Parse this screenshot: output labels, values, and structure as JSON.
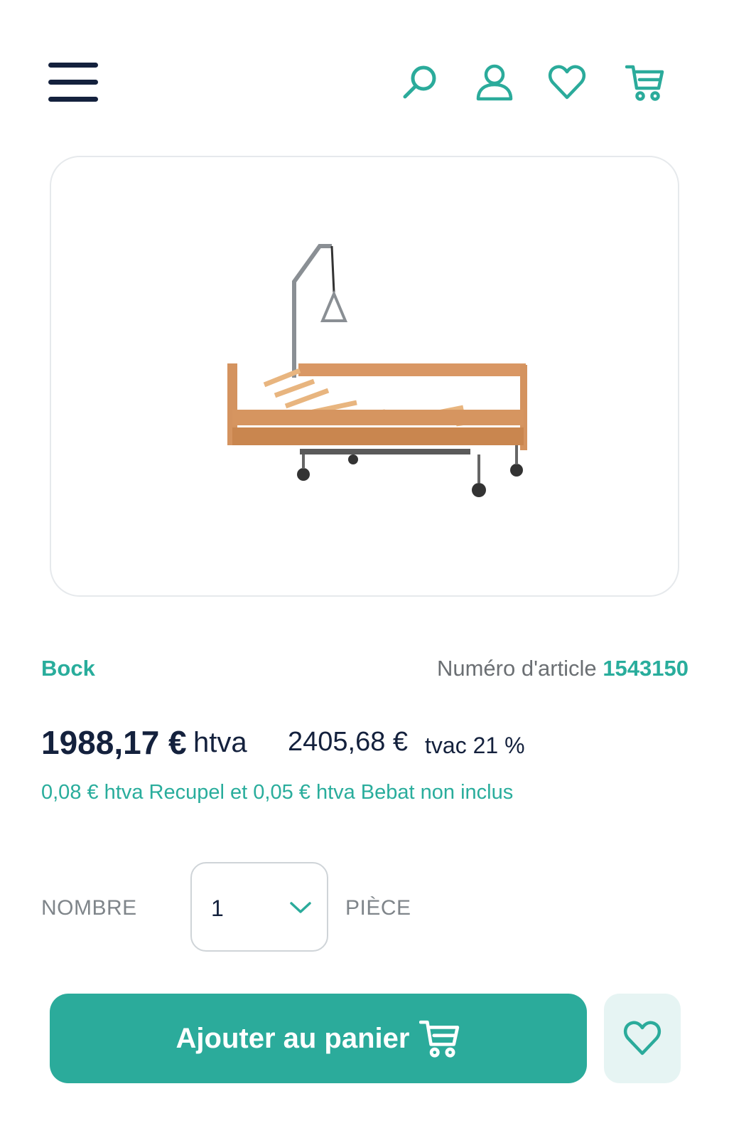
{
  "header": {
    "icons": [
      "menu-icon",
      "search-icon",
      "user-icon",
      "heart-icon",
      "cart-icon"
    ]
  },
  "product": {
    "image_alt": "hospital-bed-image",
    "brand": "Bock",
    "article_label": "Numéro d'article",
    "article_number": "1543150",
    "price_excl": "1988,17 €",
    "price_excl_suffix": "htva",
    "price_incl": "2405,68 €",
    "price_incl_suffix": "tvac 21 %",
    "recupel_note": "0,08 € htva Recupel et 0,05 € htva Bebat non inclus"
  },
  "quantity": {
    "label": "NOMBRE",
    "value": "1",
    "unit": "PIÈCE"
  },
  "actions": {
    "add_to_cart": "Ajouter au panier"
  },
  "colors": {
    "accent": "#2bab9b",
    "navy": "#14213d",
    "muted": "#7f858a"
  }
}
